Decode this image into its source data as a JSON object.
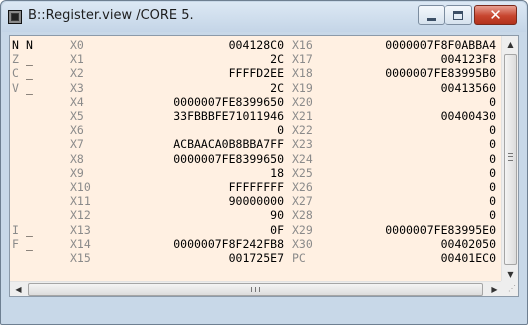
{
  "window": {
    "title": "B::Register.view /CORE 5.",
    "minimize_label": "",
    "maximize_label": "",
    "close_label": "✕",
    "icon": "trace32-app-icon"
  },
  "colors": {
    "content_bg": "#fff0e2",
    "reg_name": "#8a8a8a",
    "reg_value": "#000000",
    "close_button": "#c7452f"
  },
  "rows": [
    {
      "flag": "N",
      "fval": "N",
      "n1": "X0",
      "v1": "004128C0",
      "n2": "X16",
      "v2": "0000007F8F0ABBA4"
    },
    {
      "flag": "Z",
      "fval": "_",
      "n1": "X1",
      "v1": "2C",
      "n2": "X17",
      "v2": "004123F8"
    },
    {
      "flag": "C",
      "fval": "_",
      "n1": "X2",
      "v1": "FFFFD2EE",
      "n2": "X18",
      "v2": "0000007FE83995B0"
    },
    {
      "flag": "V",
      "fval": "_",
      "n1": "X3",
      "v1": "2C",
      "n2": "X19",
      "v2": "00413560"
    },
    {
      "flag": "",
      "fval": "",
      "n1": "X4",
      "v1": "0000007FE8399650",
      "n2": "X20",
      "v2": "0"
    },
    {
      "flag": "",
      "fval": "",
      "n1": "X5",
      "v1": "33FBBBFE71011946",
      "n2": "X21",
      "v2": "00400430"
    },
    {
      "flag": "",
      "fval": "",
      "n1": "X6",
      "v1": "0",
      "n2": "X22",
      "v2": "0"
    },
    {
      "flag": "",
      "fval": "",
      "n1": "X7",
      "v1": "ACBAACA0B8BBA7FF",
      "n2": "X23",
      "v2": "0"
    },
    {
      "flag": "",
      "fval": "",
      "n1": "X8",
      "v1": "0000007FE8399650",
      "n2": "X24",
      "v2": "0"
    },
    {
      "flag": "",
      "fval": "",
      "n1": "X9",
      "v1": "18",
      "n2": "X25",
      "v2": "0"
    },
    {
      "flag": "",
      "fval": "",
      "n1": "X10",
      "v1": "FFFFFFFF",
      "n2": "X26",
      "v2": "0"
    },
    {
      "flag": "",
      "fval": "",
      "n1": "X11",
      "v1": "90000000",
      "n2": "X27",
      "v2": "0"
    },
    {
      "flag": "",
      "fval": "",
      "n1": "X12",
      "v1": "90",
      "n2": "X28",
      "v2": "0"
    },
    {
      "flag": "I",
      "fval": "_",
      "n1": "X13",
      "v1": "0F",
      "n2": "X29",
      "v2": "0000007FE83995E0"
    },
    {
      "flag": "F",
      "fval": "_",
      "n1": "X14",
      "v1": "0000007F8F242FB8",
      "n2": "X30",
      "v2": "00402050"
    },
    {
      "flag": "",
      "fval": "",
      "n1": "X15",
      "v1": "001725E7",
      "n2": "PC",
      "v2": "00401EC0"
    }
  ],
  "scrollbars": {
    "up": "▲",
    "down": "▼",
    "left": "◀",
    "right": "▶",
    "corner": "⋰"
  }
}
